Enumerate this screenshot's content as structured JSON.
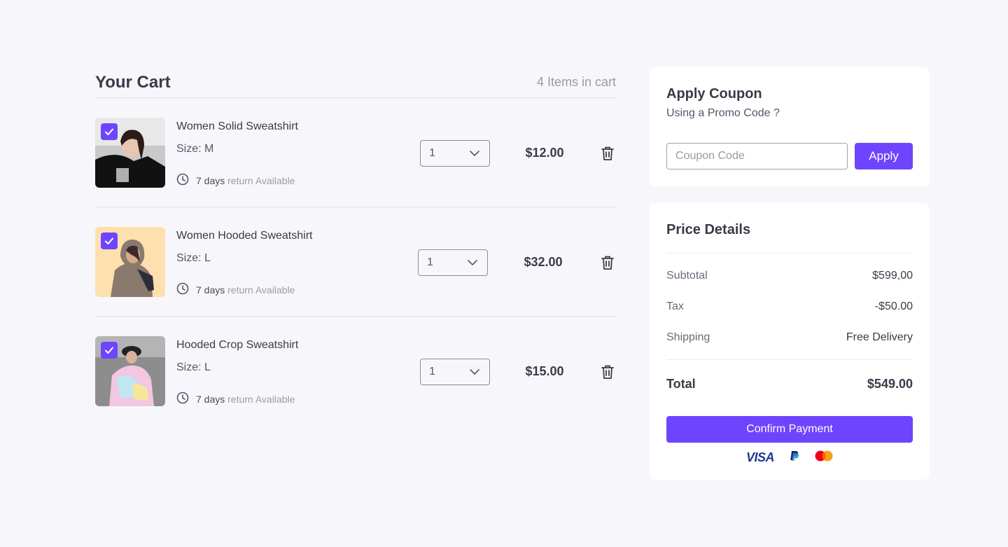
{
  "cart": {
    "title": "Your Cart",
    "count_label": "4 Items in cart",
    "items": [
      {
        "name": "Women Solid Sweatshirt",
        "size": "Size: M",
        "return_days": "7 days",
        "return_text": "return Available",
        "quantity": "1",
        "price": "$12.00",
        "checked": true
      },
      {
        "name": "Women Hooded Sweatshirt",
        "size": "Size: L",
        "return_days": "7 days",
        "return_text": "return Available",
        "quantity": "1",
        "price": "$32.00",
        "checked": true
      },
      {
        "name": "Hooded Crop Sweatshirt",
        "size": "Size: L",
        "return_days": "7 days",
        "return_text": "return Available",
        "quantity": "1",
        "price": "$15.00",
        "checked": true
      }
    ]
  },
  "coupon": {
    "title": "Apply Coupon",
    "subtitle": "Using a Promo Code ?",
    "placeholder": "Coupon Code",
    "apply_label": "Apply"
  },
  "price_details": {
    "title": "Price Details",
    "rows": [
      {
        "label": "Subtotal",
        "value": "$599,00"
      },
      {
        "label": "Tax",
        "value": "-$50.00"
      },
      {
        "label": "Shipping",
        "value": "Free Delivery"
      }
    ],
    "total_label": "Total",
    "total_value": "$549.00",
    "confirm_label": "Confirm Payment",
    "payment_methods": [
      "visa-icon",
      "paypal-icon",
      "mastercard-icon"
    ],
    "visa_text": "VISA"
  },
  "colors": {
    "accent": "#6e44ff",
    "background": "#f7f7fb",
    "text": "#3a3a48",
    "muted": "#9a9aa6"
  }
}
